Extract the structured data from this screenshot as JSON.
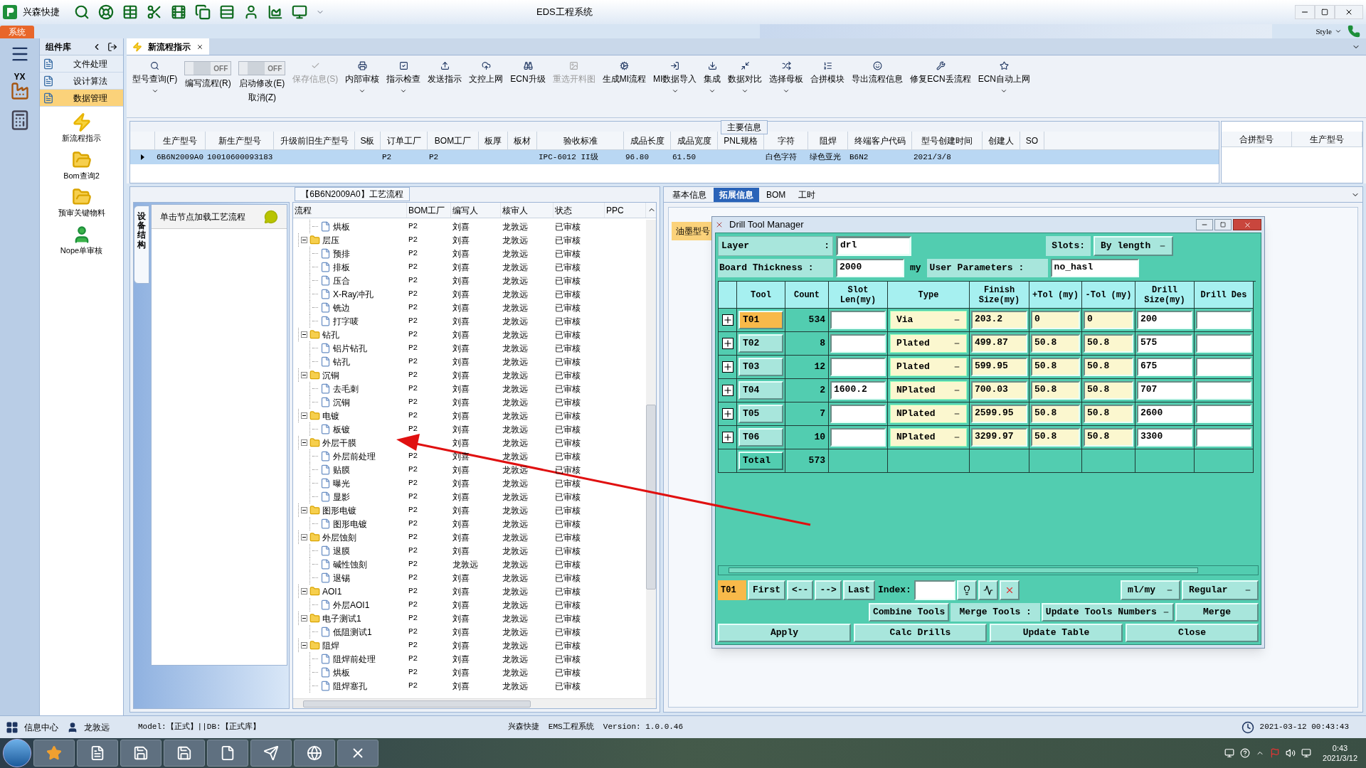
{
  "app": {
    "name": "兴森快捷",
    "logo_text": "YX",
    "title": "EDS工程系统",
    "ribbon_tab": "系统",
    "style_menu": "Style"
  },
  "doc_tab": {
    "label": "新流程指示",
    "selected": true
  },
  "toolbar": [
    {
      "kind": "button",
      "label": "型号查询(F)",
      "dropdown": true,
      "disabled": false
    },
    {
      "kind": "toggle",
      "switch_text": "OFF",
      "on": false,
      "label": "编写流程(R)"
    },
    {
      "kind": "toggle",
      "switch_text": "OFF",
      "on": false,
      "label": "启动修改(E)",
      "sublabel": "取消(Z)"
    },
    {
      "kind": "button",
      "label": "保存信息(S)",
      "dropdown": false,
      "disabled": true
    },
    {
      "kind": "button",
      "label": "内部审核",
      "dropdown": true,
      "disabled": false
    },
    {
      "kind": "button",
      "label": "指示检查",
      "dropdown": true,
      "disabled": false
    },
    {
      "kind": "button",
      "label": "发送指示",
      "dropdown": false,
      "disabled": false
    },
    {
      "kind": "button",
      "label": "文控上网",
      "dropdown": false,
      "disabled": false
    },
    {
      "kind": "button",
      "label": "ECN升级",
      "dropdown": false,
      "disabled": false
    },
    {
      "kind": "button",
      "label": "重选开料图",
      "dropdown": false,
      "disabled": true
    },
    {
      "kind": "button",
      "label": "生成MI流程",
      "dropdown": false,
      "disabled": false
    },
    {
      "kind": "button",
      "label": "MI数据导入",
      "dropdown": true,
      "disabled": false
    },
    {
      "kind": "button",
      "label": "集成",
      "dropdown": true,
      "disabled": false
    },
    {
      "kind": "button",
      "label": "数据对比",
      "dropdown": true,
      "disabled": false
    },
    {
      "kind": "button",
      "label": "选择母板",
      "dropdown": true,
      "disabled": false
    },
    {
      "kind": "button",
      "label": "合拼模块",
      "dropdown": false,
      "disabled": false
    },
    {
      "kind": "button",
      "label": "导出流程信息",
      "dropdown": false,
      "disabled": false
    },
    {
      "kind": "button",
      "label": "修复ECN丢流程",
      "dropdown": false,
      "disabled": false
    },
    {
      "kind": "button",
      "label": "ECN自动上网",
      "dropdown": true,
      "disabled": false
    }
  ],
  "sidebar": {
    "title": "组件库",
    "items": [
      {
        "label": "文件处理",
        "selected": false
      },
      {
        "label": "设计算法",
        "selected": false
      },
      {
        "label": "数据管理",
        "selected": true
      }
    ],
    "tools": [
      {
        "label": "新流程指示",
        "kind": "bolt"
      },
      {
        "label": "Bom查询2",
        "kind": "folder"
      },
      {
        "label": "预审关键物料",
        "kind": "folder"
      },
      {
        "label": "Nope单审核",
        "kind": "user"
      }
    ]
  },
  "main_info": {
    "legend": "主要信息",
    "columns": [
      "生产型号",
      "新生产型号",
      "升级前旧生产型号",
      "S板",
      "订单工厂",
      "BOM工厂",
      "板厚",
      "板材",
      "验收标准",
      "成品长度",
      "成品宽度",
      "PNL规格",
      "字符",
      "阻焊",
      "终端客户代码",
      "型号创建时间",
      "创建人",
      "SO"
    ],
    "rows": [
      {
        "selected": true,
        "cells": [
          "6B6N2009A0",
          "10010600093183",
          null,
          null,
          "P2",
          "P2",
          null,
          null,
          "IPC-6012 II级",
          "96.80",
          "61.50",
          null,
          "白色字符",
          "绿色亚光",
          "B6N2",
          "2021/3/8",
          null,
          null
        ]
      }
    ],
    "side_columns": [
      "合拼型号",
      "生产型号"
    ]
  },
  "process": {
    "title": "【6B6N2009A0】工艺流程",
    "side_tab": "设备结构",
    "hint": "单击节点加载工艺流程",
    "columns": [
      "流程",
      "BOM工厂",
      "编写人",
      "核审人",
      "状态",
      "PPC"
    ],
    "tree": [
      {
        "children": [
          {
            "name": "烘板",
            "bom": "P2",
            "writer": "刘喜",
            "reviewer": "龙敦远",
            "status": "已审核"
          }
        ]
      },
      {
        "name": "层压",
        "bom": "P2",
        "writer": "刘喜",
        "reviewer": "龙敦远",
        "status": "已审核",
        "expanded": true,
        "children": [
          {
            "name": "预排",
            "bom": "P2",
            "writer": "刘喜",
            "reviewer": "龙敦远",
            "status": "已审核"
          },
          {
            "name": "排板",
            "bom": "P2",
            "writer": "刘喜",
            "reviewer": "龙敦远",
            "status": "已审核"
          },
          {
            "name": "压合",
            "bom": "P2",
            "writer": "刘喜",
            "reviewer": "龙敦远",
            "status": "已审核"
          },
          {
            "name": "X-Ray冲孔",
            "bom": "P2",
            "writer": "刘喜",
            "reviewer": "龙敦远",
            "status": "已审核"
          },
          {
            "name": "铣边",
            "bom": "P2",
            "writer": "刘喜",
            "reviewer": "龙敦远",
            "status": "已审核"
          },
          {
            "name": "打字唛",
            "bom": "P2",
            "writer": "刘喜",
            "reviewer": "龙敦远",
            "status": "已审核"
          }
        ]
      },
      {
        "name": "钻孔",
        "bom": "P2",
        "writer": "刘喜",
        "reviewer": "龙敦远",
        "status": "已审核",
        "expanded": true,
        "children": [
          {
            "name": "铝片钻孔",
            "bom": "P2",
            "writer": "刘喜",
            "reviewer": "龙敦远",
            "status": "已审核"
          },
          {
            "name": "钻孔",
            "bom": "P2",
            "writer": "刘喜",
            "reviewer": "龙敦远",
            "status": "已审核"
          }
        ]
      },
      {
        "name": "沉铜",
        "bom": "P2",
        "writer": "刘喜",
        "reviewer": "龙敦远",
        "status": "已审核",
        "expanded": true,
        "children": [
          {
            "name": "去毛刺",
            "bom": "P2",
            "writer": "刘喜",
            "reviewer": "龙敦远",
            "status": "已审核"
          },
          {
            "name": "沉铜",
            "bom": "P2",
            "writer": "刘喜",
            "reviewer": "龙敦远",
            "status": "已审核"
          }
        ]
      },
      {
        "name": "电镀",
        "bom": "P2",
        "writer": "刘喜",
        "reviewer": "龙敦远",
        "status": "已审核",
        "expanded": true,
        "children": [
          {
            "name": "板镀",
            "bom": "P2",
            "writer": "刘喜",
            "reviewer": "龙敦远",
            "status": "已审核"
          }
        ]
      },
      {
        "name": "外层干膜",
        "writer": "刘喜",
        "reviewer": "龙敦远",
        "status": "已审核",
        "expanded": true,
        "children": [
          {
            "name": "外层前处理",
            "bom": "P2",
            "writer": "刘喜",
            "reviewer": "龙敦远",
            "status": "已审核"
          },
          {
            "name": "贴膜",
            "bom": "P2",
            "writer": "刘喜",
            "reviewer": "龙敦远",
            "status": "已审核"
          },
          {
            "name": "曝光",
            "bom": "P2",
            "writer": "刘喜",
            "reviewer": "龙敦远",
            "status": "已审核"
          },
          {
            "name": "显影",
            "bom": "P2",
            "writer": "刘喜",
            "reviewer": "龙敦远",
            "status": "已审核"
          }
        ]
      },
      {
        "name": "图形电镀",
        "bom": "P2",
        "writer": "刘喜",
        "reviewer": "龙敦远",
        "status": "已审核",
        "expanded": true,
        "children": [
          {
            "name": "图形电镀",
            "bom": "P2",
            "writer": "刘喜",
            "reviewer": "龙敦远",
            "status": "已审核"
          }
        ]
      },
      {
        "name": "外层蚀刻",
        "bom": "P2",
        "writer": "刘喜",
        "reviewer": "龙敦远",
        "status": "已审核",
        "expanded": true,
        "children": [
          {
            "name": "退膜",
            "bom": "P2",
            "writer": "刘喜",
            "reviewer": "龙敦远",
            "status": "已审核"
          },
          {
            "name": "碱性蚀刻",
            "bom": "P2",
            "writer": "龙敦远",
            "reviewer": "龙敦远",
            "status": "已审核"
          },
          {
            "name": "退锡",
            "bom": "P2",
            "writer": "刘喜",
            "reviewer": "龙敦远",
            "status": "已审核"
          }
        ]
      },
      {
        "name": "AOI1",
        "bom": "P2",
        "writer": "刘喜",
        "reviewer": "龙敦远",
        "status": "已审核",
        "expanded": true,
        "children": [
          {
            "name": "外层AOI1",
            "bom": "P2",
            "writer": "刘喜",
            "reviewer": "龙敦远",
            "status": "已审核"
          }
        ]
      },
      {
        "name": "电子测试1",
        "bom": "P2",
        "writer": "刘喜",
        "reviewer": "龙敦远",
        "status": "已审核",
        "expanded": true,
        "children": [
          {
            "name": "低阻测试1",
            "bom": "P2",
            "writer": "刘喜",
            "reviewer": "龙敦远",
            "status": "已审核"
          }
        ]
      },
      {
        "name": "阻焊",
        "bom": "P2",
        "writer": "刘喜",
        "reviewer": "龙敦远",
        "status": "已审核",
        "expanded": true,
        "children": [
          {
            "name": "阻焊前处理",
            "bom": "P2",
            "writer": "刘喜",
            "reviewer": "龙敦远",
            "status": "已审核"
          },
          {
            "name": "烘板",
            "bom": "P2",
            "writer": "刘喜",
            "reviewer": "龙敦远",
            "status": "已审核"
          },
          {
            "name": "阻焊塞孔",
            "bom": "P2",
            "writer": "刘喜",
            "reviewer": "龙敦远",
            "status": "已审核"
          }
        ]
      }
    ]
  },
  "detail_tabs": [
    {
      "label": "基本信息",
      "selected": false
    },
    {
      "label": "拓展信息",
      "selected": true
    },
    {
      "label": "BOM",
      "selected": false
    },
    {
      "label": "工时",
      "selected": false
    }
  ],
  "detail_items": [
    {
      "label": "油墨型号",
      "selected": true
    }
  ],
  "drill_tool_manager": {
    "title": "Drill Tool Manager",
    "layer_label": "Layer",
    "layer_colon": ":",
    "layer": "drl",
    "slots_label": "Slots:",
    "slots": "By length",
    "thickness_label": "Board Thickness :",
    "thickness": "2000",
    "thickness_unit": "my",
    "user_params_label": "User Parameters :",
    "user_params": "no_hasl",
    "columns": [
      "Tool",
      "Count",
      "Slot Len(my)",
      "Type",
      "Finish Size(my)",
      "+Tol (my)",
      "-Tol (my)",
      "Drill Size(my)",
      "Drill Des"
    ],
    "rows": [
      {
        "tool": "T01",
        "selected": true,
        "count": "534",
        "type": "Via",
        "finish": "203.2",
        "plus_tol": "0",
        "minus_tol": "0",
        "drill": "200"
      },
      {
        "tool": "T02",
        "selected": false,
        "count": "8",
        "type": "Plated",
        "finish": "499.87",
        "plus_tol": "50.8",
        "minus_tol": "50.8",
        "drill": "575"
      },
      {
        "tool": "T03",
        "selected": false,
        "count": "12",
        "type": "Plated",
        "finish": "599.95",
        "plus_tol": "50.8",
        "minus_tol": "50.8",
        "drill": "675"
      },
      {
        "tool": "T04",
        "selected": false,
        "count": "2",
        "slot_len": "1600.2",
        "type": "NPlated",
        "finish": "700.03",
        "plus_tol": "50.8",
        "minus_tol": "50.8",
        "drill": "707"
      },
      {
        "tool": "T05",
        "selected": false,
        "count": "7",
        "type": "NPlated",
        "finish": "2599.95",
        "plus_tol": "50.8",
        "minus_tol": "50.8",
        "drill": "2600"
      },
      {
        "tool": "T06",
        "selected": false,
        "count": "10",
        "type": "NPlated",
        "finish": "3299.97",
        "plus_tol": "50.8",
        "minus_tol": "50.8",
        "drill": "3300"
      }
    ],
    "total_label": "Total",
    "total": "573",
    "current_tool": "T01",
    "nav_buttons": [
      "First",
      "<--",
      "-->",
      "Last"
    ],
    "index_label": "Index:",
    "units": "ml/my",
    "mode": "Regular",
    "combine": "Combine Tools",
    "merge_label": "Merge Tools :",
    "merge_option": "Update Tools Numbers",
    "merge": "Merge",
    "actions": [
      "Apply",
      "Calc Drills",
      "Update Table",
      "Close"
    ]
  },
  "status_bar": {
    "info": "信息中心",
    "user": "龙敦远",
    "model": "Model:【正式】||DB:【正式库】",
    "version": "兴森快捷  EMS工程系统  Version: 1.0.0.46",
    "datetime": "2021-03-12 00:43:43"
  },
  "taskbar": {
    "time": "0:43",
    "date": "2021/3/12"
  }
}
